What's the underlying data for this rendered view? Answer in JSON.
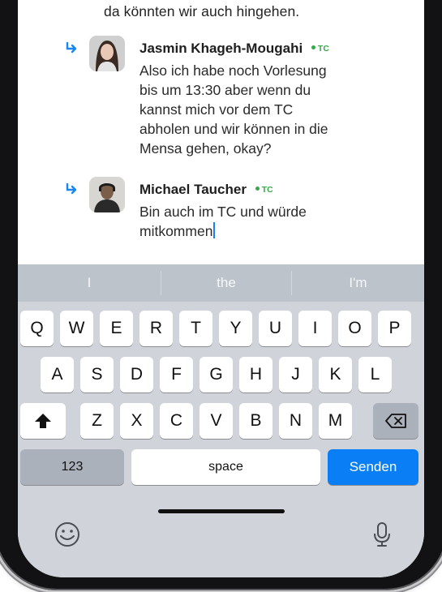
{
  "chat": {
    "previous_line": "da könnten wir auch hingehen.",
    "messages": [
      {
        "name": "Jasmin Khageh-Mougahi",
        "status": "TC",
        "lines": [
          "Also ich habe noch Vorlesung",
          "bis um 13:30 aber wenn du",
          "kannst mich vor dem TC",
          "abholen und wir können in die",
          "Mensa gehen, okay?"
        ]
      },
      {
        "name": "Michael Taucher",
        "status": "TC",
        "lines": [
          "Bin auch im TC und würde",
          "mitkommen"
        ]
      }
    ]
  },
  "keyboard": {
    "suggestions": [
      "I",
      "the",
      "I'm"
    ],
    "row1": [
      "Q",
      "W",
      "E",
      "R",
      "T",
      "Y",
      "U",
      "I",
      "O",
      "P"
    ],
    "row2": [
      "A",
      "S",
      "D",
      "F",
      "G",
      "H",
      "J",
      "K",
      "L"
    ],
    "row3": [
      "Z",
      "X",
      "C",
      "V",
      "B",
      "N",
      "M"
    ],
    "numbers_label": "123",
    "space_label": "space",
    "send_label": "Senden"
  },
  "icons": {
    "reply": "reply-arrow-icon",
    "shift": "shift-icon",
    "backspace": "backspace-icon",
    "emoji": "emoji-icon",
    "mic": "microphone-icon"
  },
  "colors": {
    "accent": "#0a7ff5",
    "status": "#36a94a"
  }
}
